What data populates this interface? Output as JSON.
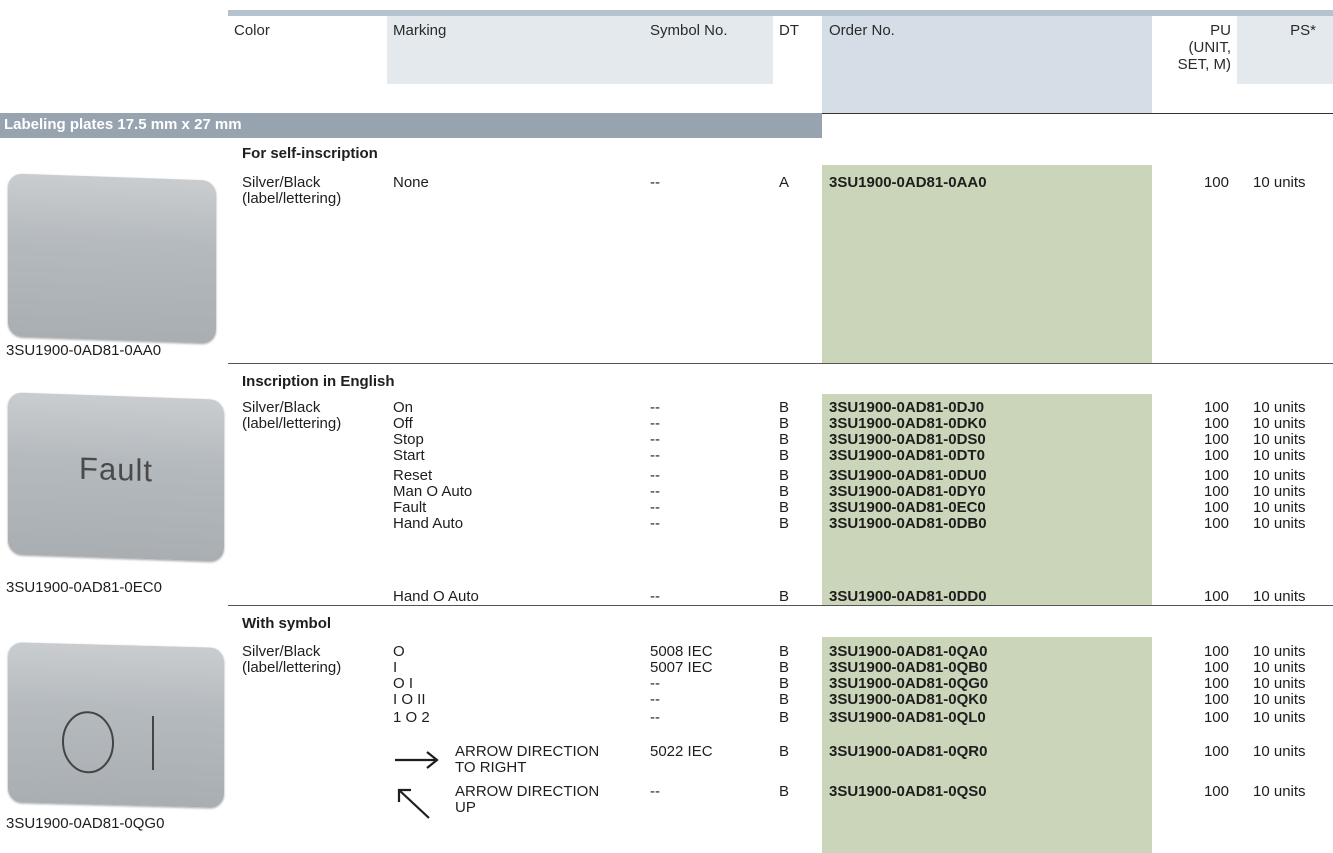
{
  "header": {
    "color": "Color",
    "marking": "Marking",
    "symbol": "Symbol No.",
    "dt": "DT",
    "order": "Order No.",
    "pu1": "PU",
    "pu2": "(UNIT,",
    "pu3": "SET, M)",
    "ps": "PS*"
  },
  "section_title": "Labeling plates 17.5 mm x 27 mm",
  "groups": [
    {
      "title": "For self-inscription",
      "color1": "Silver/Black",
      "color2": "(label/lettering)",
      "image_caption": "3SU1900-0AD81-0AA0",
      "plate_text": "",
      "rows": [
        {
          "marking": "None",
          "symbol": "--",
          "dt": "A",
          "order": "3SU1900-0AD81-0AA0",
          "pu": "100",
          "ps": "10 units"
        }
      ]
    },
    {
      "title": "Inscription in English",
      "color1": "Silver/Black",
      "color2": "(label/lettering)",
      "image_caption": "3SU1900-0AD81-0EC0",
      "plate_text": "Fault",
      "rows": [
        {
          "marking": "On",
          "symbol": "--",
          "dt": "B",
          "order": "3SU1900-0AD81-0DJ0",
          "pu": "100",
          "ps": "10 units"
        },
        {
          "marking": "Off",
          "symbol": "--",
          "dt": "B",
          "order": "3SU1900-0AD81-0DK0",
          "pu": "100",
          "ps": "10 units"
        },
        {
          "marking": "Stop",
          "symbol": "--",
          "dt": "B",
          "order": "3SU1900-0AD81-0DS0",
          "pu": "100",
          "ps": "10 units"
        },
        {
          "marking": "Start",
          "symbol": "--",
          "dt": "B",
          "order": "3SU1900-0AD81-0DT0",
          "pu": "100",
          "ps": "10 units"
        },
        {
          "marking": "Reset",
          "symbol": "--",
          "dt": "B",
          "order": "3SU1900-0AD81-0DU0",
          "pu": "100",
          "ps": "10 units"
        },
        {
          "marking": "Man O Auto",
          "symbol": "--",
          "dt": "B",
          "order": "3SU1900-0AD81-0DY0",
          "pu": "100",
          "ps": "10 units"
        },
        {
          "marking": "Fault",
          "symbol": "--",
          "dt": "B",
          "order": "3SU1900-0AD81-0EC0",
          "pu": "100",
          "ps": "10 units"
        },
        {
          "marking": "Hand Auto",
          "symbol": "--",
          "dt": "B",
          "order": "3SU1900-0AD81-0DB0",
          "pu": "100",
          "ps": "10 units"
        },
        {
          "marking": "Hand O Auto",
          "symbol": "--",
          "dt": "B",
          "order": "3SU1900-0AD81-0DD0",
          "pu": "100",
          "ps": "10 units"
        }
      ]
    },
    {
      "title": "With symbol",
      "color1": "Silver/Black",
      "color2": "(label/lettering)",
      "image_caption": "3SU1900-0AD81-0QG0",
      "plate_text": "",
      "rows": [
        {
          "marking": "O",
          "symbol": "5008 IEC",
          "dt": "B",
          "order": "3SU1900-0AD81-0QA0",
          "pu": "100",
          "ps": "10 units"
        },
        {
          "marking": "I",
          "symbol": "5007 IEC",
          "dt": "B",
          "order": "3SU1900-0AD81-0QB0",
          "pu": "100",
          "ps": "10 units"
        },
        {
          "marking": "O I",
          "symbol": "--",
          "dt": "B",
          "order": "3SU1900-0AD81-0QG0",
          "pu": "100",
          "ps": "10 units"
        },
        {
          "marking": "I O II",
          "symbol": "--",
          "dt": "B",
          "order": "3SU1900-0AD81-0QK0",
          "pu": "100",
          "ps": "10 units"
        },
        {
          "marking": "1 O 2",
          "symbol": "--",
          "dt": "B",
          "order": "3SU1900-0AD81-0QL0",
          "pu": "100",
          "ps": "10 units"
        },
        {
          "marking": "ARROW DIRECTION",
          "marking2": "TO RIGHT",
          "icon": "arrow-right-icon",
          "symbol": "5022 IEC",
          "dt": "B",
          "order": "3SU1900-0AD81-0QR0",
          "pu": "100",
          "ps": "10 units"
        },
        {
          "marking": "ARROW DIRECTION",
          "marking2": "UP",
          "icon": "arrow-up-left-icon",
          "symbol": "--",
          "dt": "B",
          "order": "3SU1900-0AD81-0QS0",
          "pu": "100",
          "ps": "10 units"
        }
      ]
    }
  ]
}
